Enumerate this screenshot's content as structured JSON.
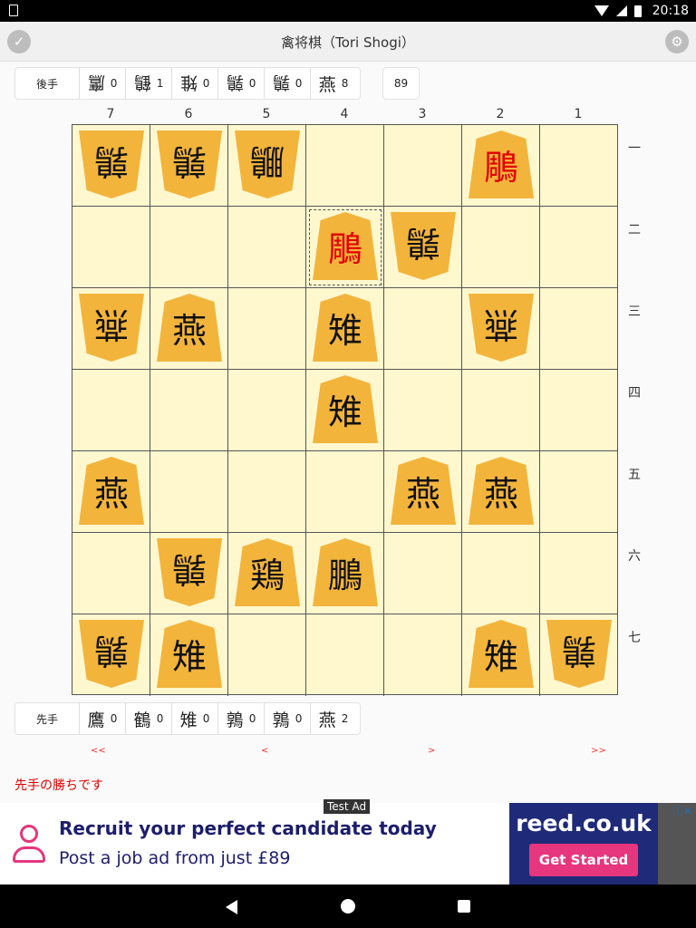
{
  "status": {
    "time": "20:18"
  },
  "appbar": {
    "title": "禽将棋（Tori Shogi）"
  },
  "gote_hand": {
    "label": "後手",
    "items": [
      {
        "kanji": "鷹",
        "count": "0"
      },
      {
        "kanji": "鶴",
        "count": "1"
      },
      {
        "kanji": "雉",
        "count": "0"
      },
      {
        "kanji": "鶉",
        "count": "0"
      },
      {
        "kanji": "鶉",
        "count": "0"
      },
      {
        "kanji": "燕",
        "count": "8"
      }
    ]
  },
  "move_count": "89",
  "columns": [
    "7",
    "6",
    "5",
    "4",
    "3",
    "2",
    "1"
  ],
  "rows": [
    "一",
    "二",
    "三",
    "四",
    "五",
    "六",
    "七"
  ],
  "board": [
    [
      {
        "k": "鶉",
        "o": "gote"
      },
      {
        "k": "鶉",
        "o": "gote"
      },
      {
        "k": "鵬",
        "o": "gote"
      },
      null,
      null,
      {
        "k": "鵰",
        "o": "sente",
        "red": true
      },
      null
    ],
    [
      null,
      null,
      null,
      {
        "k": "鵰",
        "o": "sente",
        "red": true
      },
      {
        "k": "鶉",
        "o": "gote"
      },
      null,
      null
    ],
    [
      {
        "k": "燕",
        "o": "gote"
      },
      {
        "k": "燕",
        "o": "sente"
      },
      null,
      {
        "k": "雉",
        "o": "sente"
      },
      null,
      {
        "k": "燕",
        "o": "gote"
      },
      null
    ],
    [
      null,
      null,
      null,
      {
        "k": "雉",
        "o": "sente"
      },
      null,
      null,
      null
    ],
    [
      {
        "k": "燕",
        "o": "sente"
      },
      null,
      null,
      null,
      {
        "k": "燕",
        "o": "sente"
      },
      {
        "k": "燕",
        "o": "sente"
      },
      null
    ],
    [
      null,
      {
        "k": "鶉",
        "o": "gote"
      },
      {
        "k": "鶏",
        "o": "sente"
      },
      {
        "k": "鵬",
        "o": "sente"
      },
      null,
      null,
      null
    ],
    [
      {
        "k": "鶉",
        "o": "gote"
      },
      {
        "k": "雉",
        "o": "sente"
      },
      null,
      null,
      null,
      {
        "k": "雉",
        "o": "sente"
      },
      {
        "k": "鶉",
        "o": "gote"
      }
    ]
  ],
  "selected": [
    1,
    3
  ],
  "sente_hand": {
    "label": "先手",
    "items": [
      {
        "kanji": "鷹",
        "count": "0"
      },
      {
        "kanji": "鶴",
        "count": "0"
      },
      {
        "kanji": "雉",
        "count": "0"
      },
      {
        "kanji": "鶉",
        "count": "0"
      },
      {
        "kanji": "鶉",
        "count": "0"
      },
      {
        "kanji": "燕",
        "count": "2"
      }
    ]
  },
  "nav": {
    "first": "<<",
    "prev": "<",
    "next": ">",
    "last": ">>"
  },
  "result": "先手の勝ちです",
  "ad": {
    "tag": "Test Ad",
    "headline": "Recruit your perfect candidate today",
    "subline": "Post a job ad from just £89",
    "brand": "reed.co.uk",
    "cta": "Get Started",
    "icons": "ⓘ✕"
  }
}
